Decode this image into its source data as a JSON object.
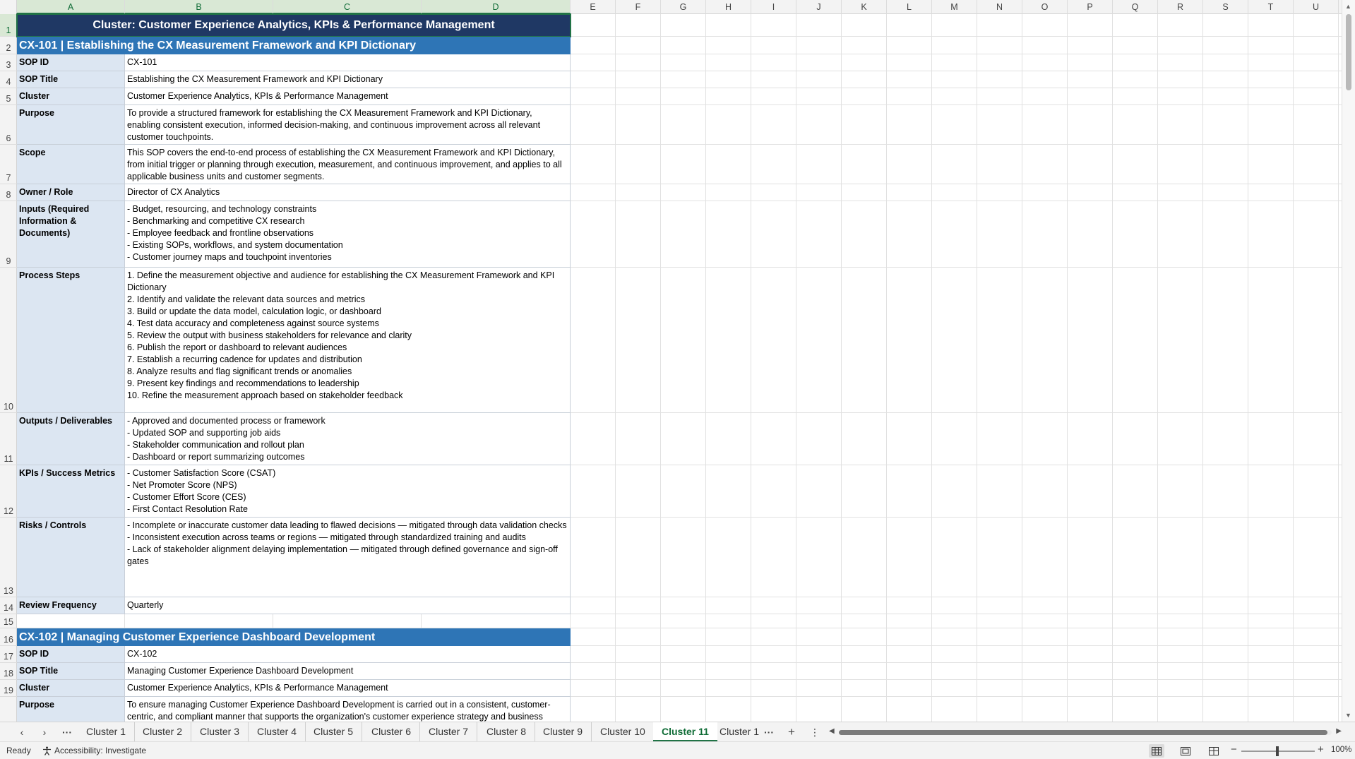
{
  "columns": [
    "A",
    "B",
    "C",
    "D",
    "E",
    "F",
    "G",
    "H",
    "I",
    "J",
    "K",
    "L",
    "M",
    "N",
    "O",
    "P",
    "Q",
    "R",
    "S",
    "T",
    "U"
  ],
  "row_numbers": [
    "1",
    "2",
    "3",
    "4",
    "5",
    "6",
    "7",
    "8",
    "9",
    "10",
    "11",
    "12",
    "13",
    "14",
    "15",
    "16",
    "17",
    "18",
    "19"
  ],
  "banner": "Cluster: Customer Experience Analytics, KPIs & Performance Management",
  "sop1": {
    "header": "CX-101  |  Establishing the CX Measurement Framework and KPI Dictionary",
    "rows": [
      {
        "label": "SOP ID",
        "value": "CX-101"
      },
      {
        "label": "SOP Title",
        "value": "Establishing the CX Measurement Framework and KPI Dictionary"
      },
      {
        "label": "Cluster",
        "value": "Customer Experience Analytics, KPIs & Performance Management"
      },
      {
        "label": "Purpose",
        "value": "To provide a structured framework for establishing the CX Measurement Framework and KPI Dictionary, enabling consistent execution, informed decision-making, and continuous improvement across all relevant customer touchpoints."
      },
      {
        "label": "Scope",
        "value": "This SOP covers the end-to-end process of establishing the CX Measurement Framework and KPI Dictionary, from initial trigger or planning through execution, measurement, and continuous improvement, and applies to all applicable business units and customer segments."
      },
      {
        "label": "Owner / Role",
        "value": "Director of CX Analytics"
      },
      {
        "label": "Inputs (Required Information & Documents)",
        "value": "- Budget, resourcing, and technology constraints\n- Benchmarking and competitive CX research\n- Employee feedback and frontline observations\n- Existing SOPs, workflows, and system documentation\n- Customer journey maps and touchpoint inventories"
      },
      {
        "label": "Process Steps",
        "value": "1. Define the measurement objective and audience for establishing the CX Measurement Framework and KPI Dictionary\n2. Identify and validate the relevant data sources and metrics\n3. Build or update the data model, calculation logic, or dashboard\n4. Test data accuracy and completeness against source systems\n5. Review the output with business stakeholders for relevance and clarity\n6. Publish the report or dashboard to relevant audiences\n7. Establish a recurring cadence for updates and distribution\n8. Analyze results and flag significant trends or anomalies\n9. Present key findings and recommendations to leadership\n10. Refine the measurement approach based on stakeholder feedback"
      },
      {
        "label": "Outputs / Deliverables",
        "value": "- Approved and documented process or framework\n- Updated SOP and supporting job aids\n- Stakeholder communication and rollout plan\n- Dashboard or report summarizing outcomes"
      },
      {
        "label": "KPIs / Success Metrics",
        "value": "- Customer Satisfaction Score (CSAT)\n- Net Promoter Score (NPS)\n- Customer Effort Score (CES)\n- First Contact Resolution Rate"
      },
      {
        "label": "Risks / Controls",
        "value": "- Incomplete or inaccurate customer data leading to flawed decisions — mitigated through data validation checks\n- Inconsistent execution across teams or regions — mitigated through standardized training and audits\n- Lack of stakeholder alignment delaying implementation — mitigated through defined governance and sign-off gates"
      },
      {
        "label": "Review Frequency",
        "value": "Quarterly"
      }
    ]
  },
  "sop2": {
    "header": "CX-102  |  Managing Customer Experience Dashboard Development",
    "rows": [
      {
        "label": "SOP ID",
        "value": "CX-102"
      },
      {
        "label": "SOP Title",
        "value": "Managing Customer Experience Dashboard Development"
      },
      {
        "label": "Cluster",
        "value": "Customer Experience Analytics, KPIs & Performance Management"
      },
      {
        "label": "Purpose",
        "value": "To ensure managing Customer Experience Dashboard Development is carried out in a consistent, customer-centric, and compliant manner that supports the organization's customer experience strategy and business"
      }
    ]
  },
  "sheet_tabs": [
    "Cluster 1",
    "Cluster 2",
    "Cluster 3",
    "Cluster 4",
    "Cluster 5",
    "Cluster 6",
    "Cluster 7",
    "Cluster 8",
    "Cluster 9",
    "Cluster 10",
    "Cluster 11",
    "Cluster 1"
  ],
  "active_tab": "Cluster 11",
  "status": {
    "ready": "Ready",
    "accessibility": "Accessibility: Investigate",
    "zoom": "100%"
  },
  "icons": {
    "tab_prev": "chevron-left-icon",
    "tab_next": "chevron-right-icon",
    "more": "ellipsis-icon",
    "add_sheet": "plus-icon",
    "accessibility": "accessibility-icon",
    "normal_view": "grid-view-icon",
    "page_layout": "page-layout-icon",
    "page_break": "page-break-icon"
  },
  "colors": {
    "banner": "#1f3864",
    "sop_header": "#2e75b6",
    "label_fill": "#dce6f2",
    "accent": "#217346"
  }
}
